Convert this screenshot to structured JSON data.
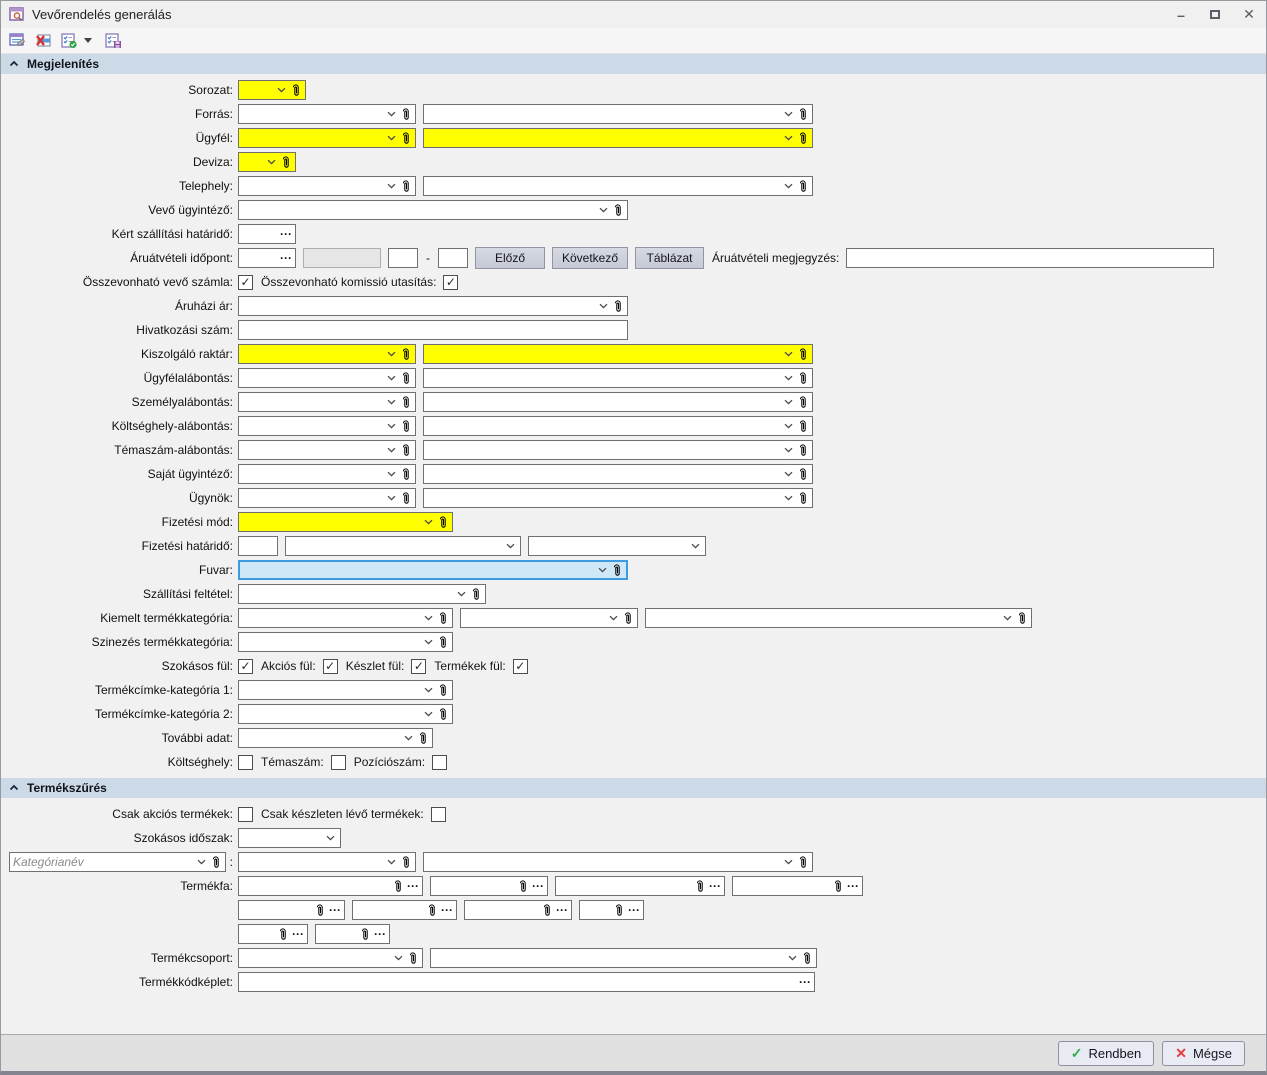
{
  "window": {
    "title": "Vevőrendelés generálás"
  },
  "icons": {
    "check": "✓",
    "cross": "✕",
    "ellipsis": "···",
    "dash": "-",
    "colon": ":",
    "minimize": "–",
    "close": "✕",
    "titlebar_app_icon": "form-search-icon",
    "toolbar": [
      "form-edit-icon",
      "form-delete-icon",
      "form-apply-check-icon",
      "form-save-icon"
    ]
  },
  "colors": {
    "highlight_yellow": "#ffff00",
    "focus_fill": "#cfe8f8",
    "focus_border": "#3f9be0",
    "section_header_bg": "#ccd9e6",
    "ok_green": "#2fae4e",
    "cancel_red": "#e04040"
  },
  "sections": [
    {
      "title": "Megjelenítés"
    },
    {
      "title": "Termékszűrés"
    }
  ],
  "labels": {
    "sorozat": "Sorozat:",
    "forras": "Forrás:",
    "ugyfel": "Ügyfél:",
    "deviza": "Deviza:",
    "telephely": "Telephely:",
    "vevo_ugyintezo": "Vevő ügyintéző:",
    "kert_szallitasi_hatarido": "Kért szállítási határidő:",
    "aruatveteli_idopont": "Áruátvételi időpont:",
    "aruatveteli_megjegyzes": "Áruátvételi  megjegyzés:",
    "osszevonhato_vevo_szamla": "Összevonható vevő számla:",
    "osszevonhato_komissio": "Összevonható komissió utasítás:",
    "aruhazi_ar": "Áruházi ár:",
    "hivatkozasi_szam": "Hivatkozási szám:",
    "kiszolgalo_raktar": "Kiszolgáló raktár:",
    "ugyfelalabontas": "Ügyfélalábontás:",
    "szemelyalabontas": "Személyalábontás:",
    "koltseghely_alabontas": "Költséghely-alábontás:",
    "temaszam_alabontas": "Témaszám-alábontás:",
    "sajat_ugyintezo": "Saját ügyintéző:",
    "ugynok": "Ügynök:",
    "fizetesi_mod": "Fizetési mód:",
    "fizetesi_hatarido": "Fizetési határidő:",
    "fuvar": "Fuvar:",
    "szallitasi_feltetel": "Szállítási feltétel:",
    "kiemelt_termekkategoria": "Kiemelt termékkategória:",
    "szinezes_termekkategoria": "Szinezés termékkategória:",
    "szokasos_ful": "Szokásos fül:",
    "akcios_ful": "Akciós fül:",
    "keszlet_ful": "Készlet fül:",
    "termekek_ful": "Termékek fül:",
    "termekcimke_kategoria_1": "Termékcímke-kategória 1:",
    "termekcimke_kategoria_2": "Termékcímke-kategória 2:",
    "tovabbi_adat": "További adat:",
    "koltseghely": "Költséghely:",
    "temaszam": "Témaszám:",
    "pozicioszam": "Pozíciószám:",
    "csak_akcios_termekek": "Csak akciós termékek:",
    "csak_keszleten": "Csak készleten lévő termékek:",
    "szokasos_idoszak": "Szokásos időszak:",
    "termekfa": "Termékfa:",
    "termekcsoport": "Termékcsoport:",
    "termekkodkeplet": "Termékkódképlet:"
  },
  "placeholders": {
    "kategorianev": "Kategórianév"
  },
  "buttons": {
    "elozo": "Előző",
    "kovetkezo": "Következő",
    "tablazat": "Táblázat",
    "rendben": "Rendben",
    "megse": "Mégse"
  },
  "checks": {
    "osszevonhato_vevo": true,
    "osszevonhato_komissio": true,
    "szokasos_ful": true,
    "akcios_ful": true,
    "keszlet_ful": true,
    "termekek_ful": true,
    "koltseghely": false,
    "temaszam": false,
    "pozicioszam": false,
    "csak_akcios": false,
    "csak_keszleten": false
  }
}
